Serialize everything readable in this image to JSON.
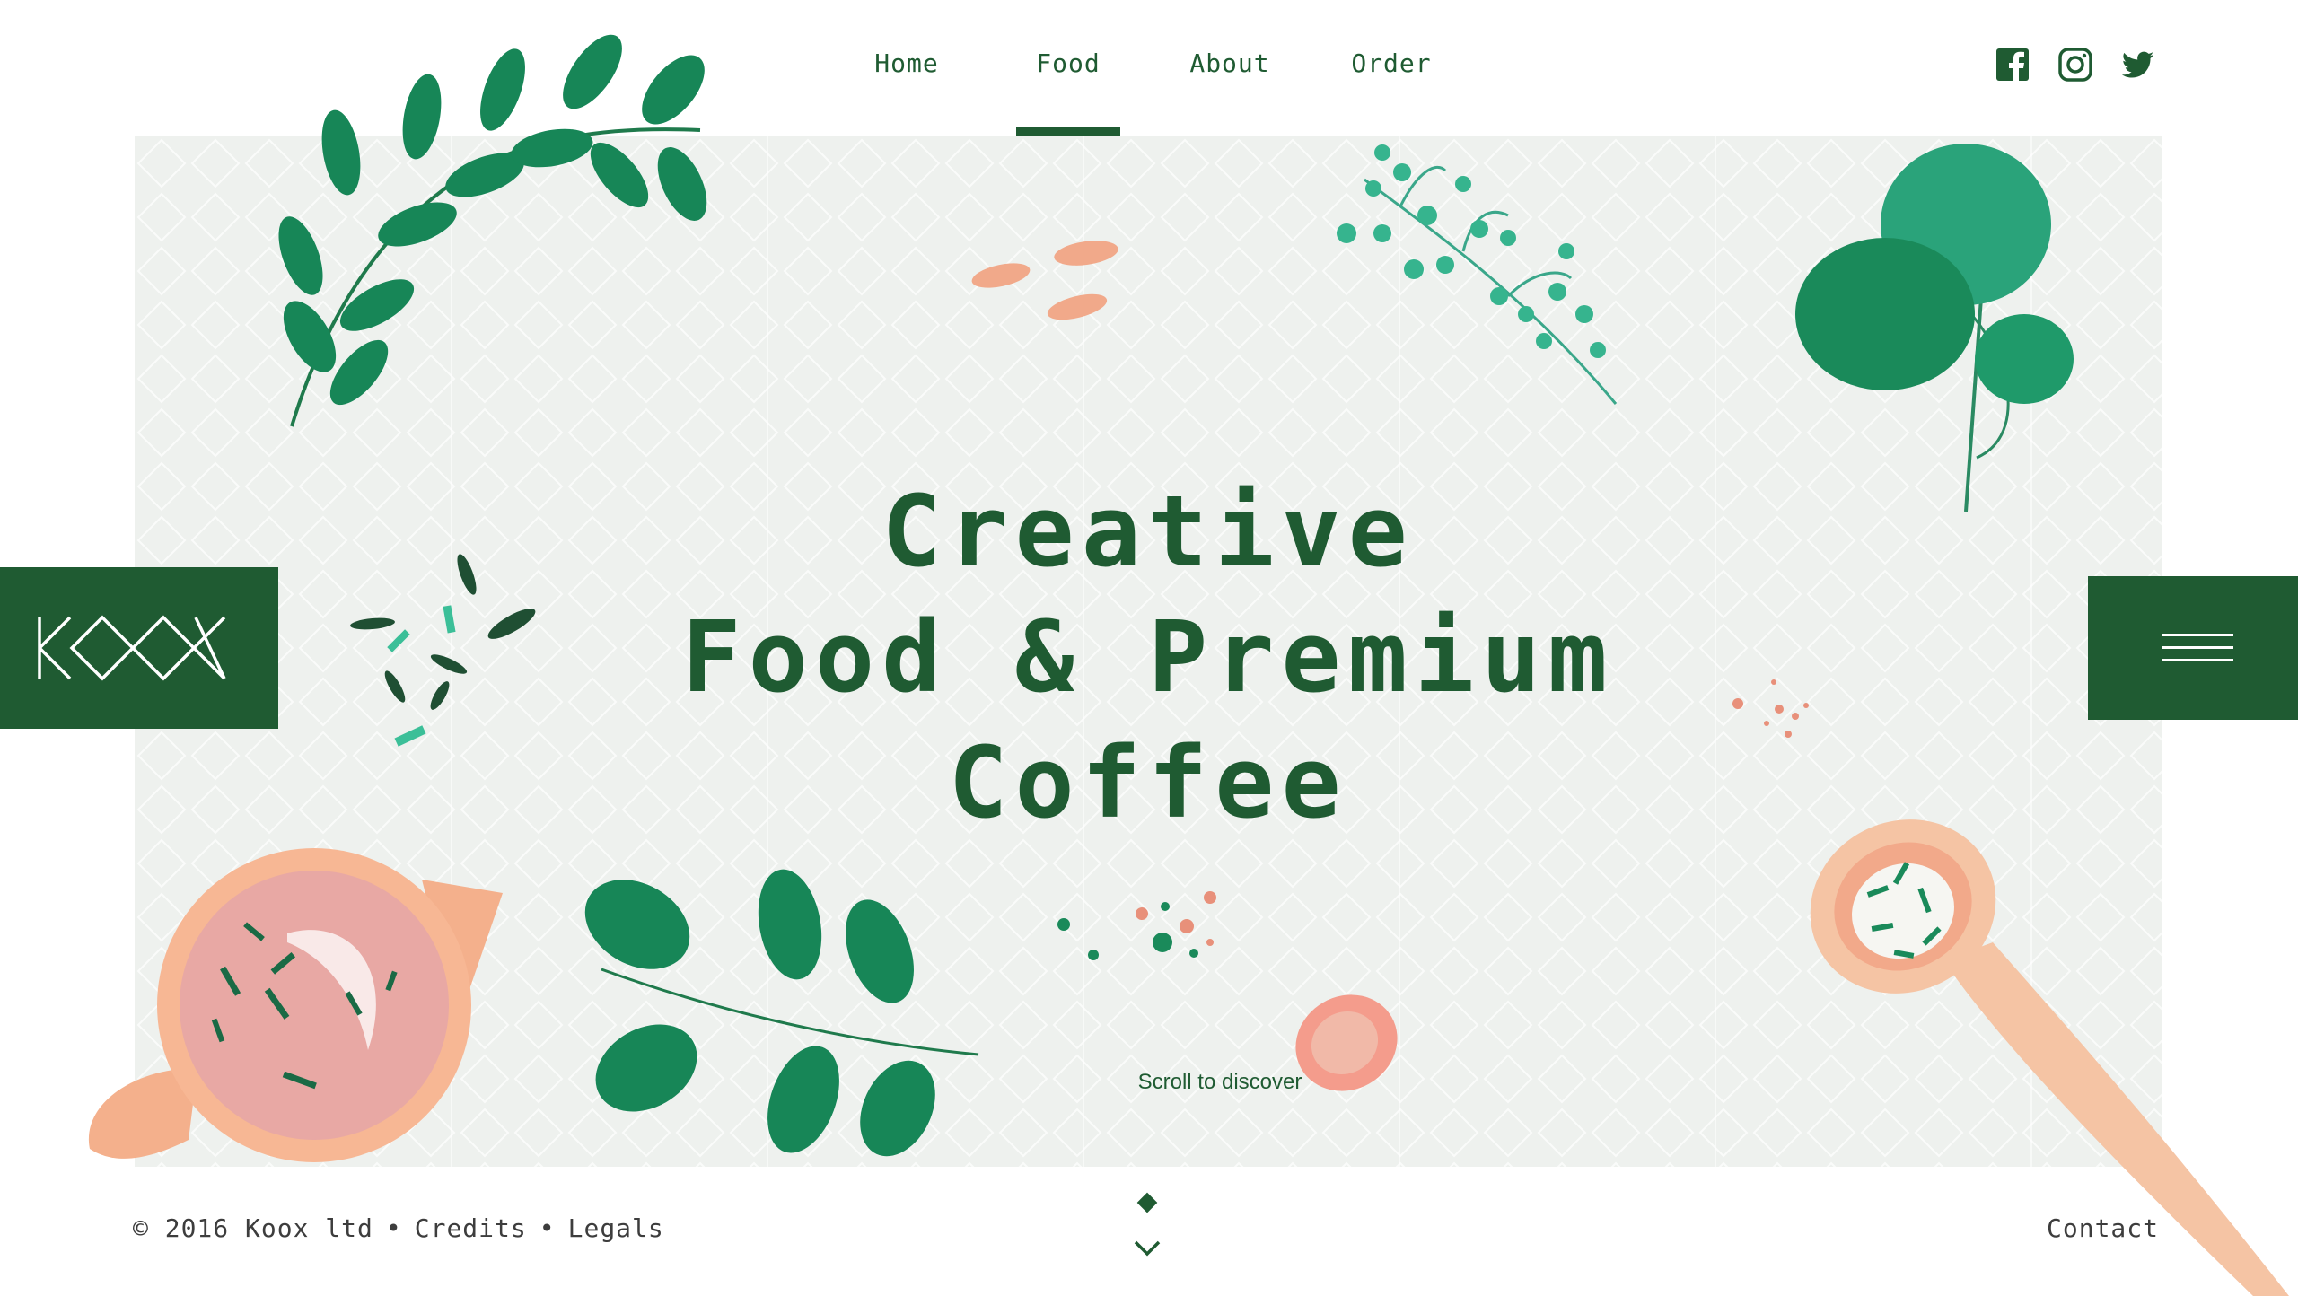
{
  "nav": {
    "items": [
      {
        "label": "Home",
        "active": false
      },
      {
        "label": "Food",
        "active": true
      },
      {
        "label": "About",
        "active": false
      },
      {
        "label": "Order",
        "active": false
      }
    ],
    "socials": [
      "facebook-icon",
      "instagram-icon",
      "twitter-icon"
    ]
  },
  "brand": {
    "logo_text": "KOOX"
  },
  "hero": {
    "headline_lines": [
      "Creative",
      "Food & Premium",
      "Coffee"
    ],
    "scroll_hint": "Scroll to discover"
  },
  "footer": {
    "copyright": "© 2016 Koox ltd",
    "separator": "•",
    "links": [
      "Credits",
      "Legals"
    ],
    "contact": "Contact"
  },
  "colors": {
    "primary_green": "#1f5b32",
    "leaf_green": "#1a8a5a",
    "panel_bg": "#eef1ee",
    "peach": "#f4b08c",
    "pink": "#e8a8a0"
  },
  "icons": {
    "menu": "hamburger-menu-icon",
    "scroll": "chevron-down-icon"
  }
}
